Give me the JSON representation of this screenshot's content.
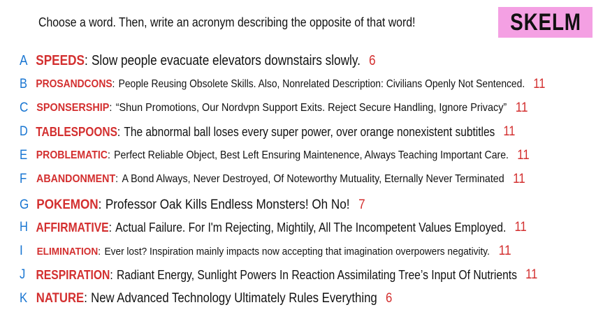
{
  "prompt": "Choose a word. Then, write an acronym describing the opposite of that word!",
  "brand": "SKELM",
  "rows": [
    {
      "letter": "A",
      "word": "SPEEDS",
      "text": "Slow people evacuate elevators downstairs slowly.",
      "count": "6"
    },
    {
      "letter": "B",
      "word": "PROSANDCONS",
      "text": "People Reusing Obsolete Skills. Also, Nonrelated Description: Civilians Openly Not Sentenced.",
      "count": "11"
    },
    {
      "letter": "C",
      "word": "SPONSERSHIP",
      "text": "“Shun Promotions, Our Nordvpn Support Exits. Reject Secure Handling, Ignore Privacy”",
      "count": "11"
    },
    {
      "letter": "D",
      "word": "TABLESPOONS",
      "text": "The abnormal ball loses every super power, over orange nonexistent subtitles",
      "count": "11"
    },
    {
      "letter": "E",
      "word": "PROBLEMATIC",
      "text": "Perfect Reliable Object, Best Left Ensuring Maintenence, Always Teaching Important Care.",
      "count": "11"
    },
    {
      "letter": "F",
      "word": "ABANDONMENT",
      "text": "A Bond Always, Never Destroyed, Of Noteworthy Mutuality, Eternally Never Terminated",
      "count": "11"
    },
    {
      "letter": "G",
      "word": "POKEMON",
      "text": "Professor Oak Kills Endless Monsters! Oh No!",
      "count": "7"
    },
    {
      "letter": "H",
      "word": "AFFIRMATIVE",
      "text": "Actual Failure. For I'm Rejecting, Mightily, All The Incompetent Values Employed.",
      "count": "11"
    },
    {
      "letter": "I",
      "word": "ELIMINATION",
      "text": "Ever lost? Inspiration mainly impacts now accepting that imagination overpowers negativity.",
      "count": "11"
    },
    {
      "letter": "J",
      "word": "RESPIRATION",
      "text": "Radiant Energy, Sunlight Powers In Reaction Assimilating Tree’s Input Of Nutrients",
      "count": "11"
    },
    {
      "letter": "K",
      "word": "NATURE",
      "text": "New Advanced Technology Ultimately Rules Everything",
      "count": "6"
    }
  ]
}
